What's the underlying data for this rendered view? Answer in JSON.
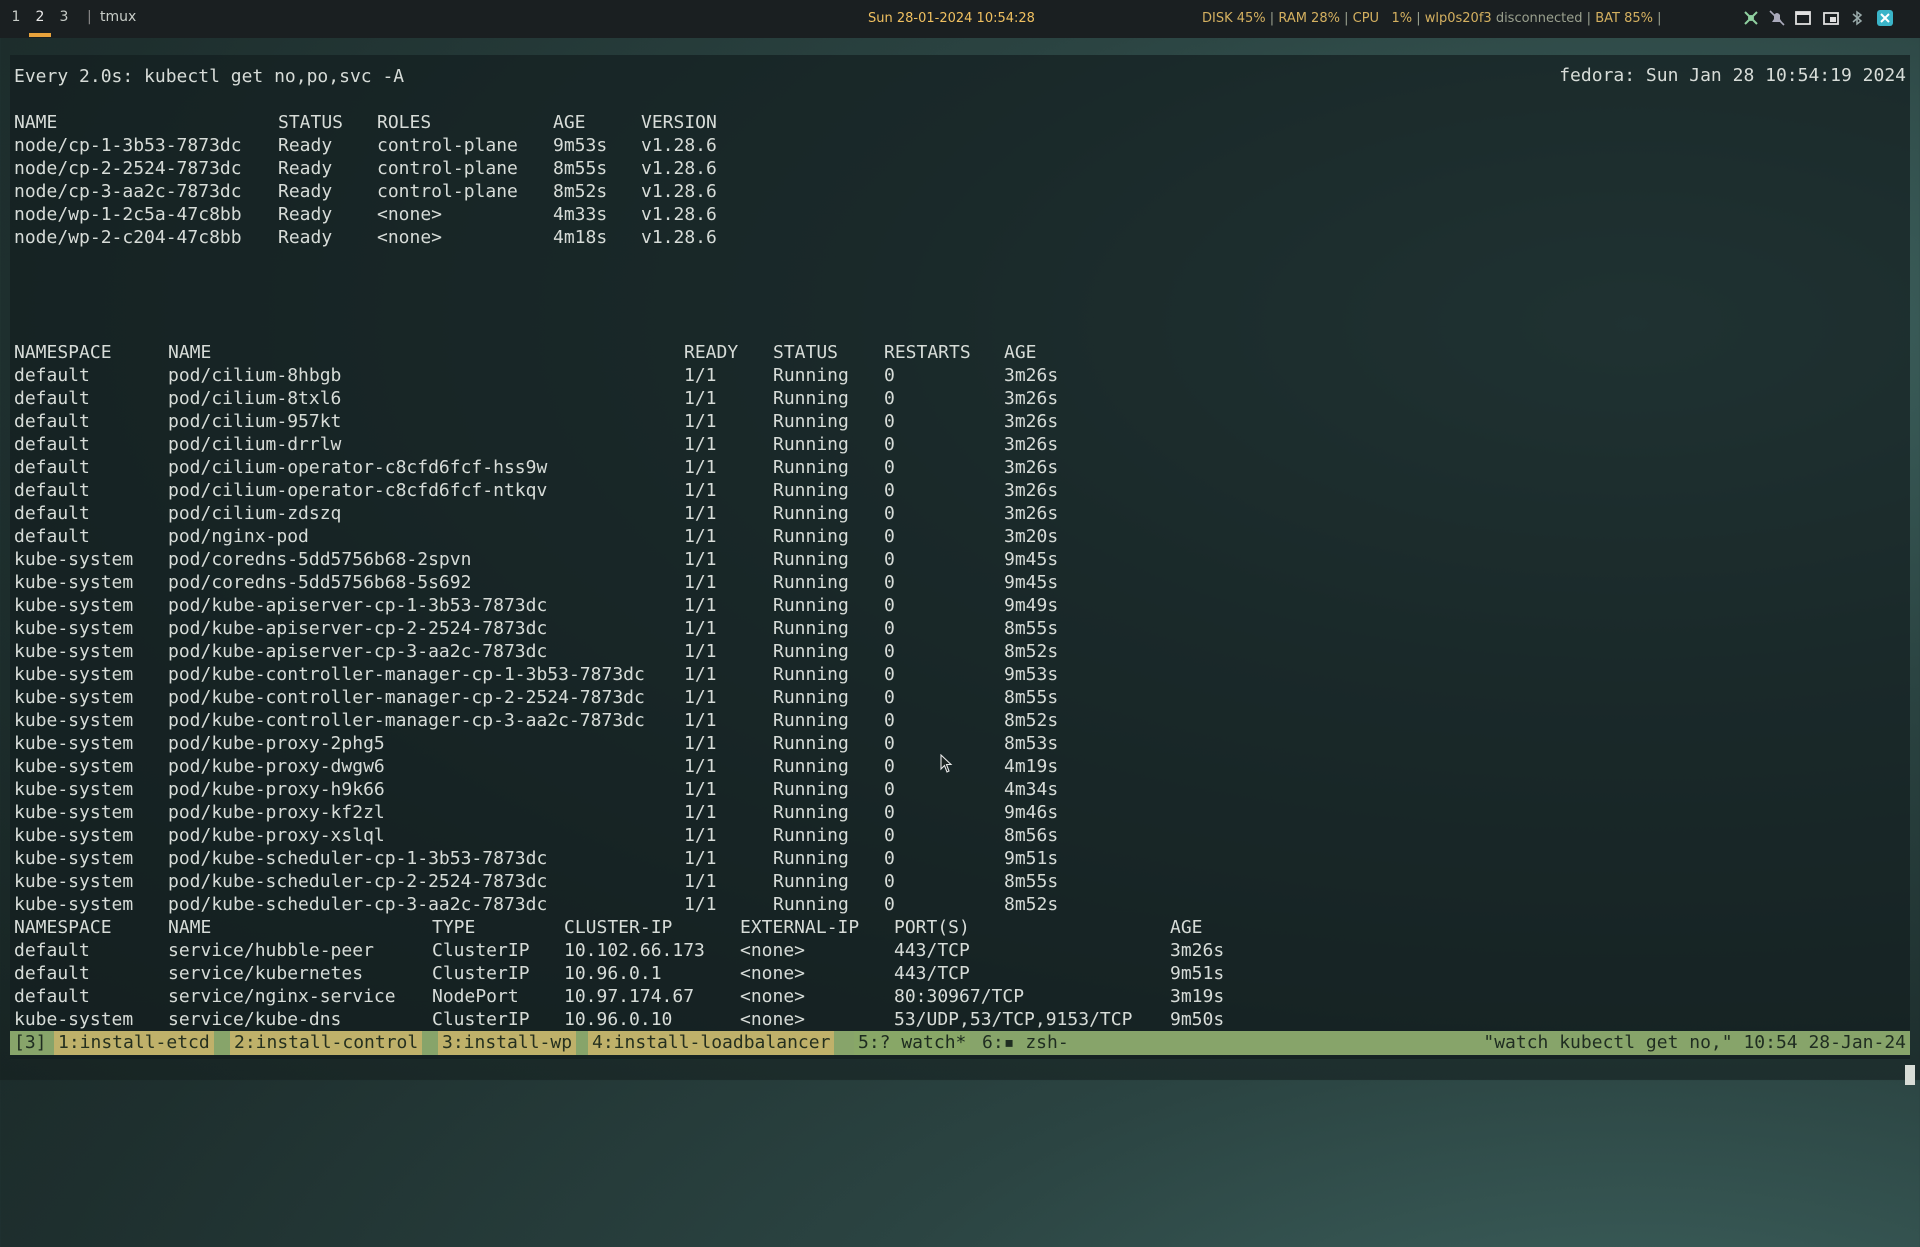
{
  "topbar": {
    "workspaces": [
      "1",
      "2",
      "3"
    ],
    "active_workspace": "2",
    "separator": "|",
    "app": "tmux",
    "clock": "Sun 28-01-2024 10:54:28",
    "status": {
      "disk": "DISK 45%",
      "ram": "RAM 28%",
      "cpu": "CPU   1%",
      "wifi_iface": "wlp0s20f3",
      "wifi_state": "disconnected",
      "battery": "BAT 85%"
    },
    "tray_icons": [
      "network-icon",
      "muted-bell-icon",
      "window-icon",
      "screenshot-icon",
      "bluetooth-icon",
      "app-icon"
    ]
  },
  "terminal": {
    "header_left": "Every 2.0s: kubectl get no,po,svc -A",
    "header_right": "fedora: Sun Jan 28 10:54:19 2024",
    "nodes": {
      "columns": [
        "NAME",
        "STATUS",
        "ROLES",
        "AGE",
        "VERSION"
      ],
      "rows": [
        [
          "node/cp-1-3b53-7873dc",
          "Ready",
          "control-plane",
          "9m53s",
          "v1.28.6"
        ],
        [
          "node/cp-2-2524-7873dc",
          "Ready",
          "control-plane",
          "8m55s",
          "v1.28.6"
        ],
        [
          "node/cp-3-aa2c-7873dc",
          "Ready",
          "control-plane",
          "8m52s",
          "v1.28.6"
        ],
        [
          "node/wp-1-2c5a-47c8bb",
          "Ready",
          "<none>",
          "4m33s",
          "v1.28.6"
        ],
        [
          "node/wp-2-c204-47c8bb",
          "Ready",
          "<none>",
          "4m18s",
          "v1.28.6"
        ]
      ]
    },
    "pods": {
      "columns": [
        "NAMESPACE",
        "NAME",
        "READY",
        "STATUS",
        "RESTARTS",
        "AGE"
      ],
      "rows": [
        [
          "default",
          "pod/cilium-8hbgb",
          "1/1",
          "Running",
          "0",
          "3m26s"
        ],
        [
          "default",
          "pod/cilium-8txl6",
          "1/1",
          "Running",
          "0",
          "3m26s"
        ],
        [
          "default",
          "pod/cilium-957kt",
          "1/1",
          "Running",
          "0",
          "3m26s"
        ],
        [
          "default",
          "pod/cilium-drrlw",
          "1/1",
          "Running",
          "0",
          "3m26s"
        ],
        [
          "default",
          "pod/cilium-operator-c8cfd6fcf-hss9w",
          "1/1",
          "Running",
          "0",
          "3m26s"
        ],
        [
          "default",
          "pod/cilium-operator-c8cfd6fcf-ntkqv",
          "1/1",
          "Running",
          "0",
          "3m26s"
        ],
        [
          "default",
          "pod/cilium-zdszq",
          "1/1",
          "Running",
          "0",
          "3m26s"
        ],
        [
          "default",
          "pod/nginx-pod",
          "1/1",
          "Running",
          "0",
          "3m20s"
        ],
        [
          "kube-system",
          "pod/coredns-5dd5756b68-2spvn",
          "1/1",
          "Running",
          "0",
          "9m45s"
        ],
        [
          "kube-system",
          "pod/coredns-5dd5756b68-5s692",
          "1/1",
          "Running",
          "0",
          "9m45s"
        ],
        [
          "kube-system",
          "pod/kube-apiserver-cp-1-3b53-7873dc",
          "1/1",
          "Running",
          "0",
          "9m49s"
        ],
        [
          "kube-system",
          "pod/kube-apiserver-cp-2-2524-7873dc",
          "1/1",
          "Running",
          "0",
          "8m55s"
        ],
        [
          "kube-system",
          "pod/kube-apiserver-cp-3-aa2c-7873dc",
          "1/1",
          "Running",
          "0",
          "8m52s"
        ],
        [
          "kube-system",
          "pod/kube-controller-manager-cp-1-3b53-7873dc",
          "1/1",
          "Running",
          "0",
          "9m53s"
        ],
        [
          "kube-system",
          "pod/kube-controller-manager-cp-2-2524-7873dc",
          "1/1",
          "Running",
          "0",
          "8m55s"
        ],
        [
          "kube-system",
          "pod/kube-controller-manager-cp-3-aa2c-7873dc",
          "1/1",
          "Running",
          "0",
          "8m52s"
        ],
        [
          "kube-system",
          "pod/kube-proxy-2phg5",
          "1/1",
          "Running",
          "0",
          "8m53s"
        ],
        [
          "kube-system",
          "pod/kube-proxy-dwgw6",
          "1/1",
          "Running",
          "0",
          "4m19s"
        ],
        [
          "kube-system",
          "pod/kube-proxy-h9k66",
          "1/1",
          "Running",
          "0",
          "4m34s"
        ],
        [
          "kube-system",
          "pod/kube-proxy-kf2zl",
          "1/1",
          "Running",
          "0",
          "9m46s"
        ],
        [
          "kube-system",
          "pod/kube-proxy-xslql",
          "1/1",
          "Running",
          "0",
          "8m56s"
        ],
        [
          "kube-system",
          "pod/kube-scheduler-cp-1-3b53-7873dc",
          "1/1",
          "Running",
          "0",
          "9m51s"
        ],
        [
          "kube-system",
          "pod/kube-scheduler-cp-2-2524-7873dc",
          "1/1",
          "Running",
          "0",
          "8m55s"
        ],
        [
          "kube-system",
          "pod/kube-scheduler-cp-3-aa2c-7873dc",
          "1/1",
          "Running",
          "0",
          "8m52s"
        ]
      ]
    },
    "services": {
      "columns": [
        "NAMESPACE",
        "NAME",
        "TYPE",
        "CLUSTER-IP",
        "EXTERNAL-IP",
        "PORT(S)",
        "AGE"
      ],
      "rows": [
        [
          "default",
          "service/hubble-peer",
          "ClusterIP",
          "10.102.66.173",
          "<none>",
          "443/TCP",
          "3m26s"
        ],
        [
          "default",
          "service/kubernetes",
          "ClusterIP",
          "10.96.0.1",
          "<none>",
          "443/TCP",
          "9m51s"
        ],
        [
          "default",
          "service/nginx-service",
          "NodePort",
          "10.97.174.67",
          "<none>",
          "80:30967/TCP",
          "3m19s"
        ],
        [
          "kube-system",
          "service/kube-dns",
          "ClusterIP",
          "10.96.0.10",
          "<none>",
          "53/UDP,53/TCP,9153/TCP",
          "9m50s"
        ]
      ]
    }
  },
  "tmux": {
    "session": "[3]",
    "windows": [
      {
        "label": "1:install-etcd"
      },
      {
        "label": "2:install-control"
      },
      {
        "label": "3:install-wp"
      },
      {
        "label": "4:install-loadbalancer"
      },
      {
        "label": "5:? watch*"
      },
      {
        "label": "6:▪ zsh-"
      }
    ],
    "right": "\"watch kubectl get no,\" 10:54 28-Jan-24"
  }
}
